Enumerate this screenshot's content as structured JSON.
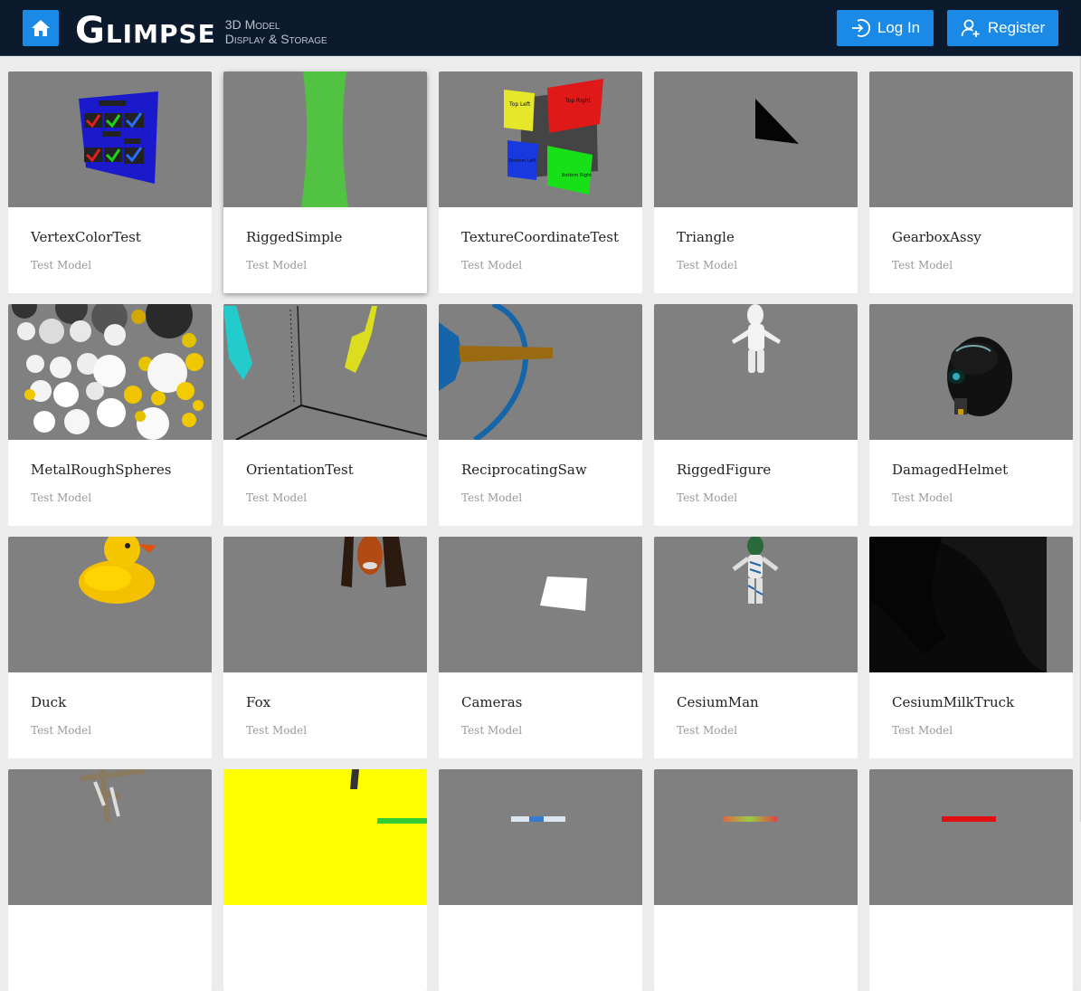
{
  "app": {
    "logo": "Glimpse",
    "tagline_line1": "3D Model",
    "tagline_line2": "Display & Storage"
  },
  "nav": {
    "login_label": "Log In",
    "register_label": "Register"
  },
  "models": [
    {
      "title": "VertexColorTest",
      "subtitle": "Test Model"
    },
    {
      "title": "RiggedSimple",
      "subtitle": "Test Model"
    },
    {
      "title": "TextureCoordinateTest",
      "subtitle": "Test Model"
    },
    {
      "title": "Triangle",
      "subtitle": "Test Model"
    },
    {
      "title": "GearboxAssy",
      "subtitle": "Test Model"
    },
    {
      "title": "MetalRoughSpheres",
      "subtitle": "Test Model"
    },
    {
      "title": "OrientationTest",
      "subtitle": "Test Model"
    },
    {
      "title": "ReciprocatingSaw",
      "subtitle": "Test Model"
    },
    {
      "title": "RiggedFigure",
      "subtitle": "Test Model"
    },
    {
      "title": "DamagedHelmet",
      "subtitle": "Test Model"
    },
    {
      "title": "Duck",
      "subtitle": "Test Model"
    },
    {
      "title": "Fox",
      "subtitle": "Test Model"
    },
    {
      "title": "Cameras",
      "subtitle": "Test Model"
    },
    {
      "title": "CesiumMan",
      "subtitle": "Test Model"
    },
    {
      "title": "CesiumMilkTruck",
      "subtitle": "Test Model"
    }
  ],
  "texture_test_labels": {
    "top_left": "Top Left",
    "top_right": "Top Right",
    "bottom_left": "Bottom Left",
    "bottom_right": "Bottom Right"
  },
  "colors": {
    "navbar": "#0c1a2e",
    "accent": "#1a8ae6",
    "thumb_background": "#808080",
    "page_background": "#ececec"
  }
}
